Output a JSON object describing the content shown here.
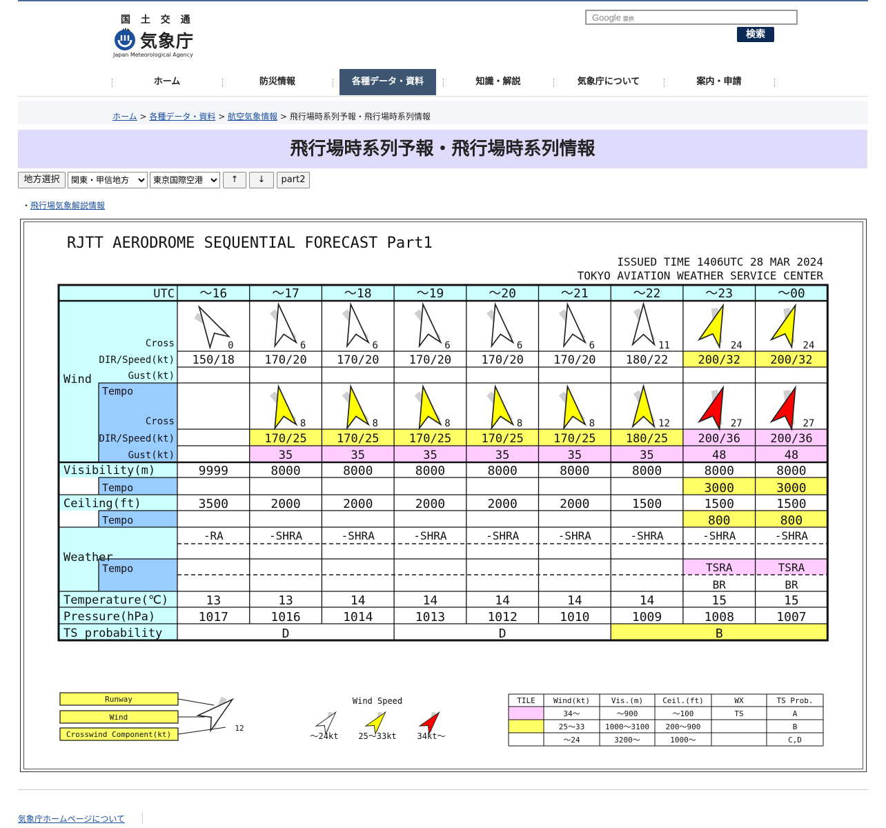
{
  "header": {
    "ministry": "国 土 交 通 省",
    "agency": "気象庁",
    "agency_en": "Japan Meteorological Agency",
    "search_brand": "Google",
    "search_sub": "提供",
    "search_button": "検索"
  },
  "nav": [
    "ホーム",
    "防災情報",
    "各種データ・資料",
    "知識・解説",
    "気象庁について",
    "案内・申請"
  ],
  "nav_active_index": 2,
  "breadcrumb": {
    "items": [
      "ホーム",
      "各種データ・資料",
      "航空気象情報"
    ],
    "current": "飛行場時系列予報・飛行場時系列情報",
    "separator": ">"
  },
  "page_title": "飛行場時系列予報・飛行場時系列情報",
  "controls": {
    "region_button": "地方選択",
    "region_select": "関東・甲信地方",
    "airport_select": "東京国際空港",
    "up_button": "↑",
    "down_button": "↓",
    "part2_button": "part2"
  },
  "info_link": "飛行場気象解説情報",
  "forecast": {
    "title": "RJTT  AERODROME SEQUENTIAL FORECAST Part1",
    "issued": "ISSUED TIME 1406UTC 28 MAR 2024",
    "center": "TOKYO AVIATION WEATHER SERVICE CENTER",
    "labels": {
      "utc": "UTC",
      "wind": "Wind",
      "cross": "Cross",
      "dirspeed": "DIR/Speed(kt)",
      "gust": "Gust(kt)",
      "tempo": "Tempo",
      "visibility": "Visibility(m)",
      "ceiling": "Ceiling(ft)",
      "weather": "Weather",
      "temperature": "Temperature(℃)",
      "pressure": "Pressure(hPa)",
      "ts": "TS probability"
    },
    "hours": [
      "～16",
      "～17",
      "～18",
      "～19",
      "～20",
      "～21",
      "～22",
      "～23",
      "～00"
    ],
    "wind_dir": [
      "150/18",
      "170/20",
      "170/20",
      "170/20",
      "170/20",
      "170/20",
      "180/22",
      "200/32",
      "200/32"
    ],
    "wind_dir_hl": [
      "",
      "",
      "",
      "",
      "",
      "",
      "",
      "yellow",
      "yellow"
    ],
    "wind_cross": [
      "0",
      "6",
      "6",
      "6",
      "6",
      "6",
      "11",
      "24",
      "24"
    ],
    "wind_arrow": [
      "white",
      "white",
      "white",
      "white",
      "white",
      "white",
      "white",
      "yellow",
      "yellow"
    ],
    "wind_deg": [
      150,
      170,
      170,
      170,
      170,
      170,
      180,
      200,
      200
    ],
    "tempo_dir": [
      "",
      "170/25",
      "170/25",
      "170/25",
      "170/25",
      "170/25",
      "180/25",
      "200/36",
      "200/36"
    ],
    "tempo_dir_hl": [
      "",
      "yellow",
      "yellow",
      "yellow",
      "yellow",
      "yellow",
      "yellow",
      "pink",
      "pink"
    ],
    "tempo_cross": [
      "",
      "8",
      "8",
      "8",
      "8",
      "8",
      "12",
      "27",
      "27"
    ],
    "tempo_arrow": [
      "",
      "yellow",
      "yellow",
      "yellow",
      "yellow",
      "yellow",
      "yellow",
      "red",
      "red"
    ],
    "tempo_deg": [
      0,
      170,
      170,
      170,
      170,
      170,
      180,
      200,
      200
    ],
    "tempo_gust": [
      "",
      "35",
      "35",
      "35",
      "35",
      "35",
      "35",
      "48",
      "48"
    ],
    "visibility": [
      "9999",
      "8000",
      "8000",
      "8000",
      "8000",
      "8000",
      "8000",
      "8000",
      "8000"
    ],
    "visibility_tempo": [
      "",
      "",
      "",
      "",
      "",
      "",
      "",
      "3000",
      "3000"
    ],
    "ceiling": [
      "3500",
      "2000",
      "2000",
      "2000",
      "2000",
      "2000",
      "1500",
      "1500",
      "1500"
    ],
    "ceiling_tempo": [
      "",
      "",
      "",
      "",
      "",
      "",
      "",
      "800",
      "800"
    ],
    "weather": [
      "-RA",
      "-SHRA",
      "-SHRA",
      "-SHRA",
      "-SHRA",
      "-SHRA",
      "-SHRA",
      "-SHRA",
      "-SHRA"
    ],
    "weather_tempo_1": [
      "",
      "",
      "",
      "",
      "",
      "",
      "",
      "TSRA",
      "TSRA"
    ],
    "weather_tempo_2": [
      "",
      "",
      "",
      "",
      "",
      "",
      "",
      "BR",
      "BR"
    ],
    "temperature": [
      "13",
      "13",
      "14",
      "14",
      "14",
      "14",
      "14",
      "15",
      "15"
    ],
    "pressure": [
      "1017",
      "1016",
      "1014",
      "1013",
      "1012",
      "1010",
      "1009",
      "1008",
      "1007"
    ],
    "ts_probability": [
      {
        "value": "D",
        "span": 3,
        "hl": ""
      },
      {
        "value": "D",
        "span": 3,
        "hl": ""
      },
      {
        "value": "B",
        "span": 3,
        "hl": "yellow"
      }
    ]
  },
  "legend": {
    "runway": "Runway",
    "wind": "Wind",
    "crosswind": "Crosswind Component(kt)",
    "sample_cross": "12",
    "wind_speed_title": "Wind Speed",
    "speed_low": "～24kt",
    "speed_mid": "25～33kt",
    "speed_high": "34kt～",
    "table_headers": [
      "TILE",
      "Wind(kt)",
      "Vis.(m)",
      "Ceil.(ft)",
      "WX",
      "TS Prob."
    ],
    "table_rows": [
      {
        "tile": "pink",
        "cells": [
          "34～",
          "～900",
          "～100",
          "TS",
          "A"
        ]
      },
      {
        "tile": "yellow",
        "cells": [
          "25～33",
          "1000～3100",
          "200～900",
          "",
          "B"
        ]
      },
      {
        "tile": "",
        "cells": [
          "～24",
          "3200～",
          "1000～",
          "",
          "C,D"
        ]
      }
    ]
  },
  "colors": {
    "cyan": "#ccffff",
    "blue": "#99ccff",
    "yellow": "#ffff66",
    "pink": "#ffccff",
    "arrow_yellow": "#ffff00",
    "arrow_red": "#ff0000",
    "title_band": "#dedcfa",
    "nav_active": "#3d5570"
  },
  "footer_link": "気象庁ホームページについて"
}
